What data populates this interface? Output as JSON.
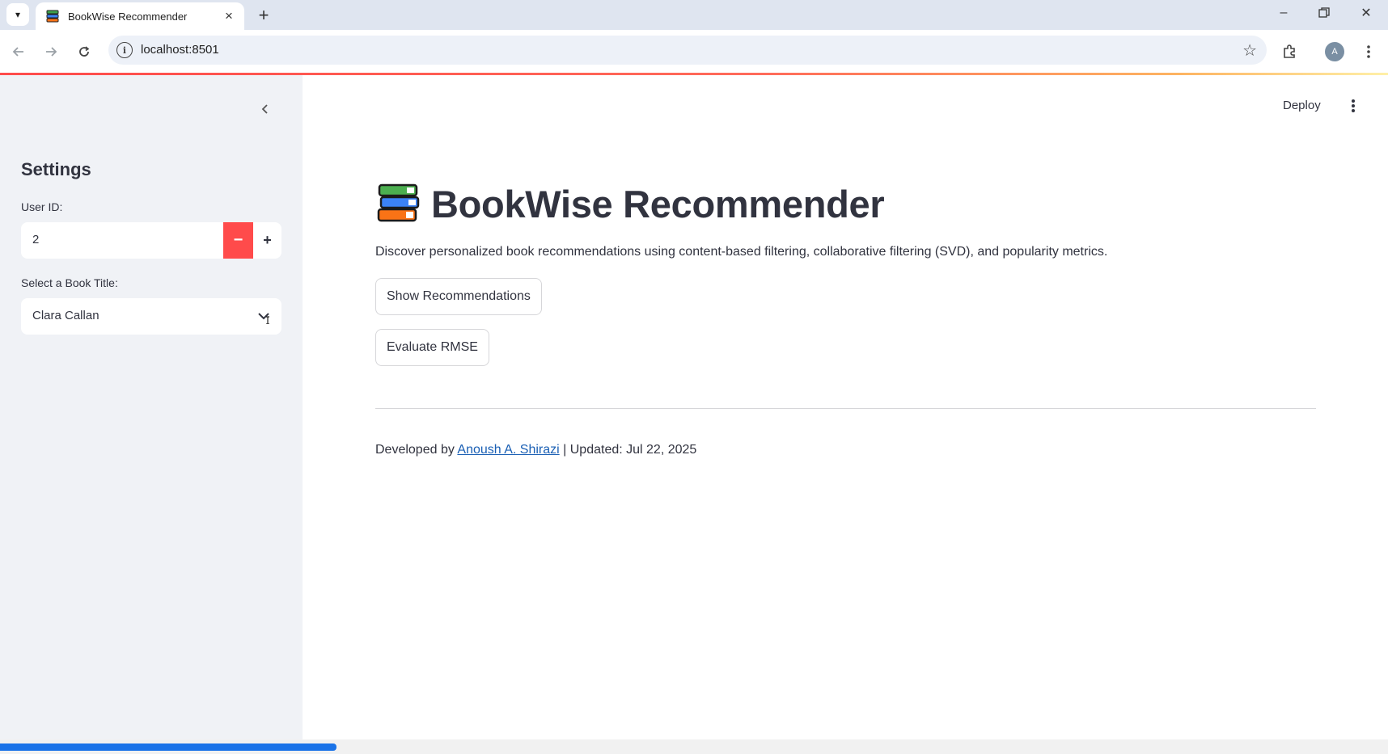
{
  "browser": {
    "tab_title": "BookWise Recommender",
    "url": "localhost:8501",
    "profile_initial": "A",
    "icons": [
      "tab-search-icon",
      "close-icon",
      "plus-icon",
      "minimize-icon",
      "restore-icon",
      "back-icon",
      "forward-icon",
      "reload-icon",
      "site-info-icon",
      "star-icon",
      "puzzle-icon",
      "kebab-icon"
    ]
  },
  "sidebar": {
    "title": "Settings",
    "user_id_label": "User ID:",
    "user_id_value": "2",
    "book_label": "Select a Book Title:",
    "book_value": "Clara Callan"
  },
  "header": {
    "deploy_label": "Deploy"
  },
  "main": {
    "title": "BookWise Recommender",
    "description": "Discover personalized book recommendations using content-based filtering, collaborative filtering (SVD), and popularity metrics.",
    "show_button": "Show Recommendations",
    "evaluate_button": "Evaluate RMSE",
    "footer_prefix": "Developed by ",
    "author": "Anoush A. Shirazi",
    "footer_suffix": " | Updated: Jul 22, 2025"
  },
  "colors": {
    "accent": "#ff4b4b",
    "sidebar_bg": "#f0f2f6",
    "text": "#31333f",
    "link": "#1a5fb4",
    "tabbar_bg": "#dfe5f0"
  },
  "scroll_position_fraction": 0.24
}
